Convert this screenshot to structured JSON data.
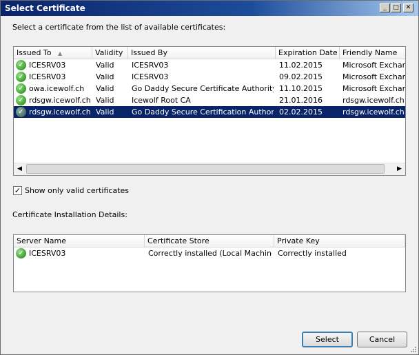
{
  "window": {
    "title": "Select Certificate",
    "buttons": {
      "minimize": "_",
      "maximize": "□",
      "close": "✕"
    }
  },
  "instruction": "Select a certificate from the list of available certificates:",
  "cert_table": {
    "columns": [
      "Issued To",
      "Validity",
      "Issued By",
      "Expiration Date",
      "Friendly Name"
    ],
    "rows": [
      {
        "issued_to": "ICESRV03",
        "validity": "Valid",
        "issued_by": "ICESRV03",
        "expiration": "11.02.2015",
        "friendly": "Microsoft Exchange",
        "selected": false
      },
      {
        "issued_to": "ICESRV03",
        "validity": "Valid",
        "issued_by": "ICESRV03",
        "expiration": "09.02.2015",
        "friendly": "Microsoft Exchange",
        "selected": false
      },
      {
        "issued_to": "owa.icewolf.ch",
        "validity": "Valid",
        "issued_by": "Go Daddy Secure Certificate Authority ...",
        "expiration": "11.10.2015",
        "friendly": "Microsoft Exchange",
        "selected": false
      },
      {
        "issued_to": "rdsgw.icewolf.ch",
        "validity": "Valid",
        "issued_by": "Icewolf Root CA",
        "expiration": "21.01.2016",
        "friendly": "rdsgw.icewolf.ch",
        "selected": false
      },
      {
        "issued_to": "rdsgw.icewolf.ch",
        "validity": "Valid",
        "issued_by": "Go Daddy Secure Certification Authority",
        "expiration": "02.02.2015",
        "friendly": "rdsgw.icewolf.ch",
        "selected": true
      }
    ]
  },
  "show_valid_only": {
    "label": "Show only valid certificates",
    "checked": true
  },
  "details_label": "Certificate Installation Details:",
  "install_table": {
    "columns": [
      "Server Name",
      "Certificate Store",
      "Private Key"
    ],
    "rows": [
      {
        "server": "ICESRV03",
        "store": "Correctly installed (Local Machine,...",
        "key": "Correctly installed"
      }
    ]
  },
  "buttons": {
    "select": "Select",
    "cancel": "Cancel"
  },
  "colors": {
    "selection": "#0a246a",
    "title_bar": "#0a246a",
    "valid_icon": "#3a9d2a"
  }
}
